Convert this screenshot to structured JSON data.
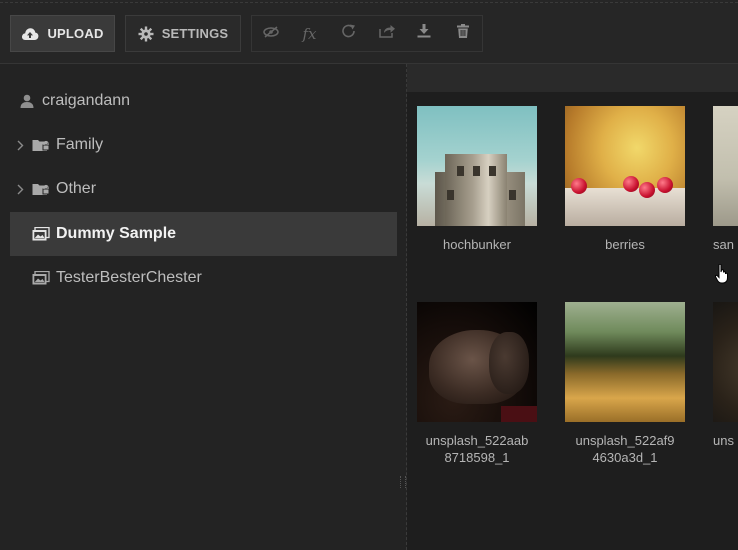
{
  "toolbar": {
    "upload_label": "UPLOAD",
    "settings_label": "SETTINGS",
    "icon_buttons": [
      "eye-slash-icon",
      "fx-icon",
      "redo-icon",
      "share-icon",
      "download-icon",
      "trash-icon"
    ]
  },
  "sidebar": {
    "user": "craigandann",
    "items": [
      {
        "label": "Family",
        "expandable": true,
        "icon": "folder-lock-icon"
      },
      {
        "label": "Other",
        "expandable": true,
        "icon": "folder-lock-icon"
      },
      {
        "label": "Dummy Sample",
        "expandable": false,
        "icon": "album-icon",
        "selected": true
      },
      {
        "label": "TesterBesterChester",
        "expandable": false,
        "icon": "album-icon"
      }
    ]
  },
  "gallery": {
    "items": [
      {
        "caption": "hochbunker"
      },
      {
        "caption": "berries"
      },
      {
        "caption": "san"
      },
      {
        "caption": "unsplash_522aab\n8718598_1",
        "line1": "unsplash_522aab",
        "line2": "8718598_1"
      },
      {
        "caption": "unsplash_522af9\n4630a3d_1",
        "line1": "unsplash_522af9",
        "line2": "4630a3d_1"
      },
      {
        "caption": "uns"
      }
    ]
  },
  "colors": {
    "background": "#232323",
    "selected_row": "#3a3a3a",
    "primary_button": "#3a3a3a"
  }
}
